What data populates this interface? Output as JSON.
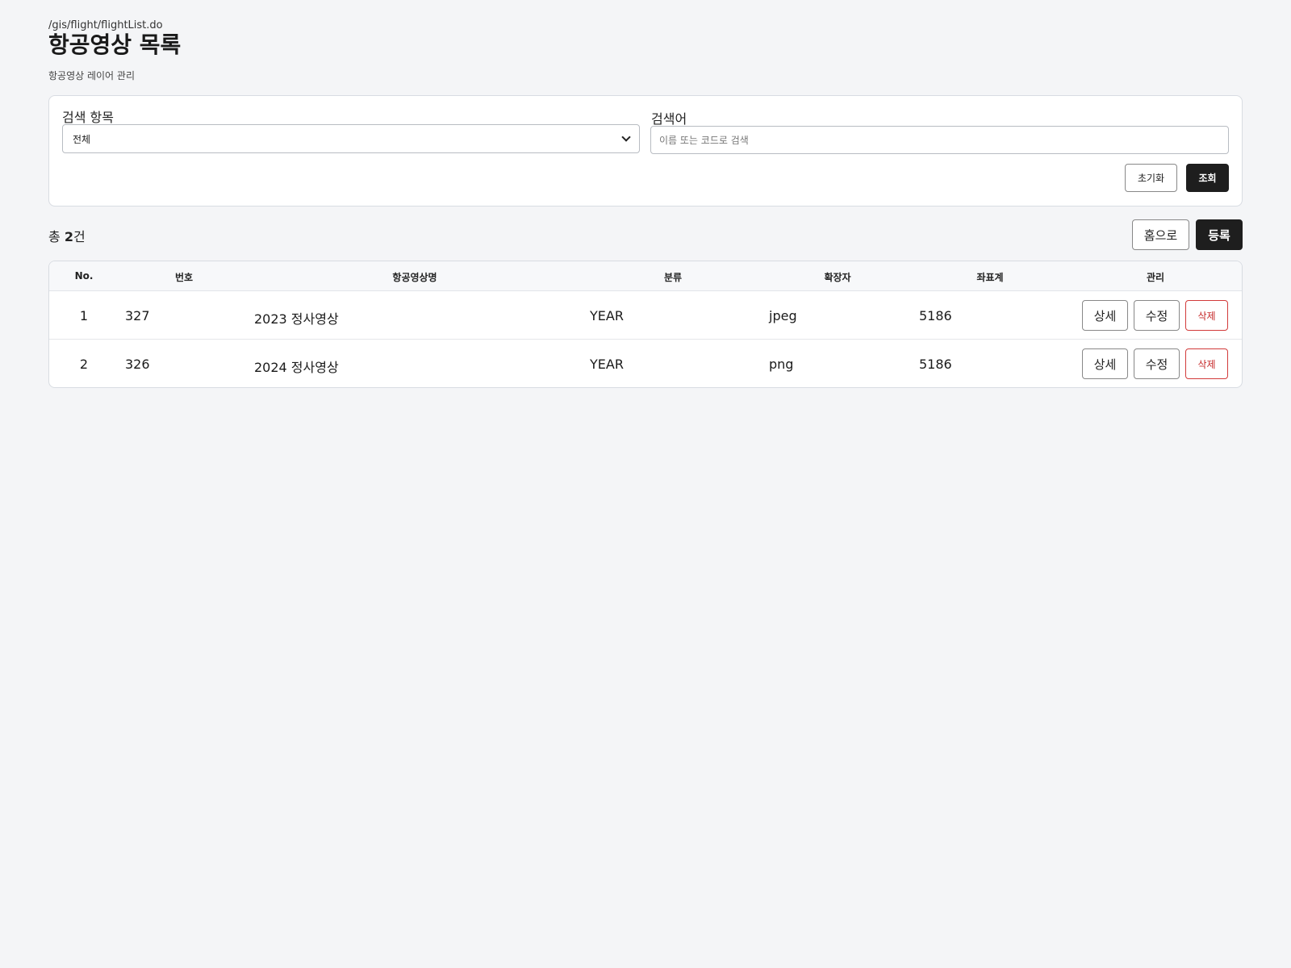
{
  "header": {
    "path": "/gis/flight/flightList.do",
    "title": "항공영상 목록",
    "subtitle": "항공영상 레이어 관리"
  },
  "search": {
    "field_label": "검색 항목",
    "field_value": "전체",
    "keyword_label": "검색어",
    "keyword_placeholder": "이름 또는 코드로 검색",
    "keyword_value": "",
    "reset_label": "초기화",
    "submit_label": "조회"
  },
  "summary": {
    "prefix": "총 ",
    "count": "2",
    "suffix": "건"
  },
  "actions": {
    "home_label": "홈으로",
    "register_label": "등록"
  },
  "table": {
    "columns": {
      "no": "No.",
      "id": "번호",
      "name": "항공영상명",
      "category": "분류",
      "extension": "확장자",
      "crs": "좌표계",
      "manage": "관리"
    },
    "rows": [
      {
        "no": "1",
        "id": "327",
        "name": "2023 정사영상",
        "category": "YEAR",
        "extension": "jpeg",
        "crs": "5186",
        "detail": "상세",
        "edit": "수정",
        "delete": "삭제"
      },
      {
        "no": "2",
        "id": "326",
        "name": "2024 정사영상",
        "category": "YEAR",
        "extension": "png",
        "crs": "5186",
        "detail": "상세",
        "edit": "수정",
        "delete": "삭제"
      }
    ]
  },
  "colors": {
    "background": "#f4f5f7",
    "primary_button": "#1e1e1e",
    "danger": "#c62828"
  }
}
